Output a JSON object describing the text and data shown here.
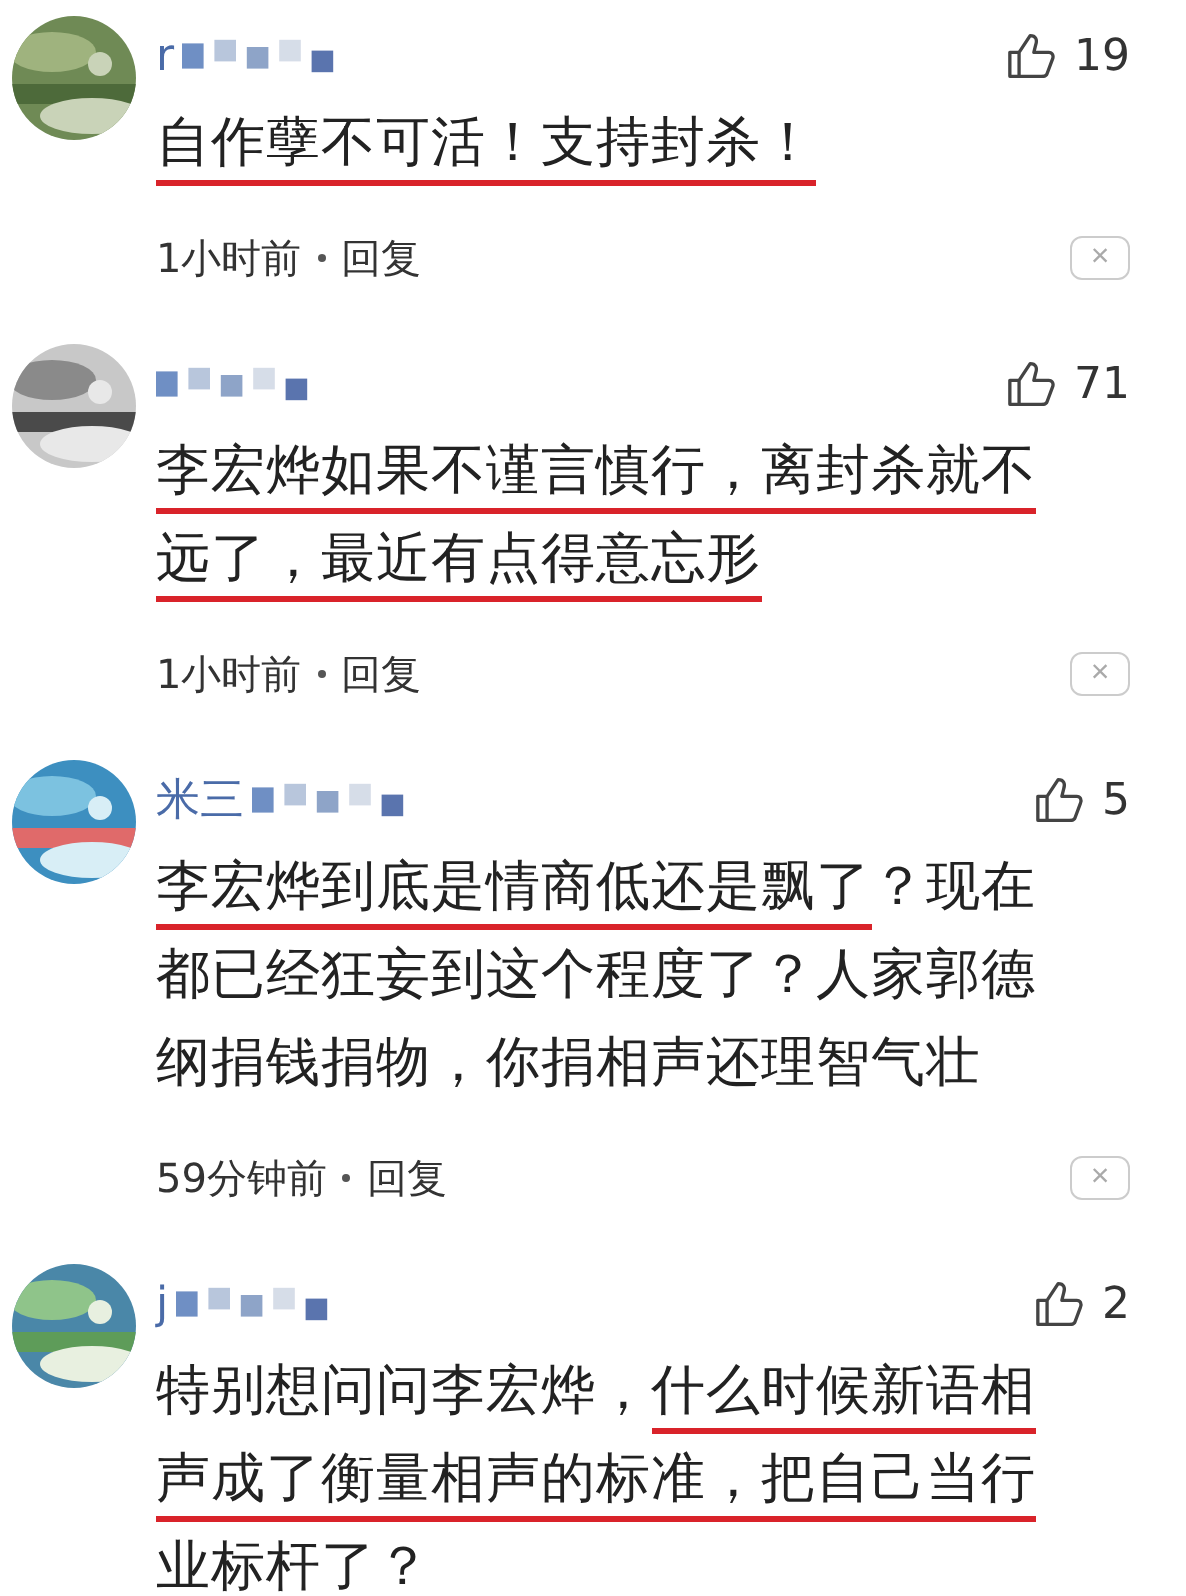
{
  "comments": [
    {
      "name": "r",
      "name_masked": true,
      "likes": "19",
      "lines": [
        [
          {
            "text": "自作孽不可活！支持封杀！",
            "underlined": true
          }
        ]
      ],
      "time": "1小时前",
      "reply": "回复",
      "dismiss": "×"
    },
    {
      "name_masked": true,
      "likes": "71",
      "lines": [
        [
          {
            "text": "李宏烨如果不谨言慎行，离封杀就不",
            "underlined": true
          }
        ],
        [
          {
            "text": "远了，最近有点得意忘形",
            "underlined": true
          }
        ]
      ],
      "time": "1小时前",
      "reply": "回复",
      "dismiss": "×"
    },
    {
      "name": "米三",
      "name_masked": true,
      "likes": "5",
      "lines": [
        [
          {
            "text": "李宏烨到底是情商低还是飘了",
            "underlined": true
          },
          {
            "text": "？现在",
            "underlined": false
          }
        ],
        [
          {
            "text": "都已经狂妄到这个程度了？人家郭德",
            "underlined": false
          }
        ],
        [
          {
            "text": "纲捐钱捐物，你捐相声还理智气壮",
            "underlined": false
          }
        ]
      ],
      "time": "59分钟前",
      "reply": "回复",
      "dismiss": "×"
    },
    {
      "name": "j",
      "name_masked": true,
      "likes": "2",
      "lines": [
        [
          {
            "text": "特别想问问李宏烨，",
            "underlined": false
          },
          {
            "text": "什么时候新语相",
            "underlined": true
          }
        ],
        [
          {
            "text": "声成了衡量相声的标准，把自己当行",
            "underlined": true
          }
        ],
        [
          {
            "text": "业标杆了？"
          }
        ]
      ]
    }
  ]
}
